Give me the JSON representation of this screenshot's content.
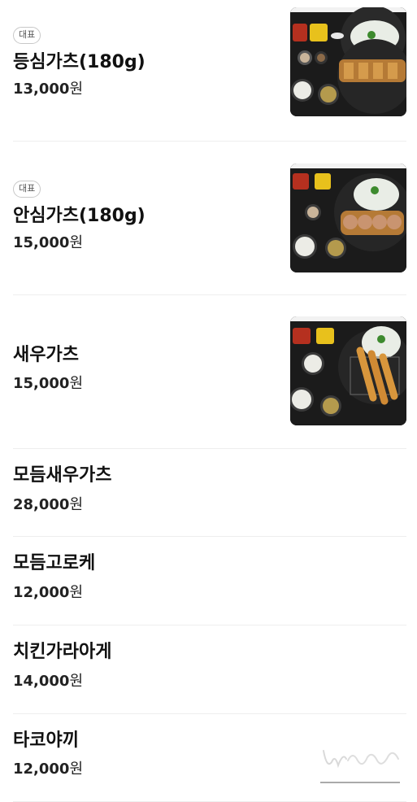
{
  "menu": {
    "items": [
      {
        "badge": "대표",
        "name": "등심가츠(180g)",
        "price": "13,000",
        "currency": "원",
        "photo": "tonkatsu-set-photo"
      },
      {
        "badge": "대표",
        "name": "안심가츠(180g)",
        "price": "15,000",
        "currency": "원",
        "photo": "tenderloin-katsu-set-photo"
      },
      {
        "name": "새우가츠",
        "price": "15,000",
        "currency": "원",
        "photo": "shrimp-katsu-set-photo"
      },
      {
        "name": "모듬새우가츠",
        "price": "28,000",
        "currency": "원"
      },
      {
        "name": "모듬고로케",
        "price": "12,000",
        "currency": "원"
      },
      {
        "name": "치킨가라아게",
        "price": "14,000",
        "currency": "원"
      },
      {
        "name": "타코야끼",
        "price": "12,000",
        "currency": "원"
      }
    ]
  },
  "watermark": "watermark-logo",
  "colors": {
    "divider": "#eeeeee",
    "text": "#111111",
    "badge_border": "#c8c8c8",
    "photo_bg": "#1a1a1a"
  }
}
